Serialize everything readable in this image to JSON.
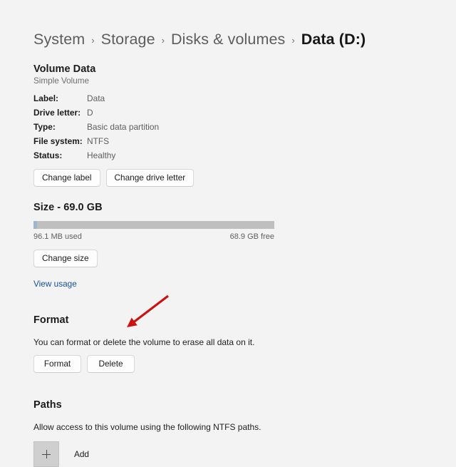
{
  "breadcrumb": {
    "separator": "›",
    "items": [
      {
        "label": "System",
        "current": false
      },
      {
        "label": "Storage",
        "current": false
      },
      {
        "label": "Disks & volumes",
        "current": false
      },
      {
        "label": "Data (D:)",
        "current": true
      }
    ]
  },
  "volume": {
    "title": "Volume Data",
    "subtitle": "Simple Volume",
    "properties": [
      {
        "key": "Label:",
        "value": "Data"
      },
      {
        "key": "Drive letter:",
        "value": "D"
      },
      {
        "key": "Type:",
        "value": "Basic data partition"
      },
      {
        "key": "File system:",
        "value": "NTFS"
      },
      {
        "key": "Status:",
        "value": "Healthy"
      }
    ],
    "change_label_button": "Change label",
    "change_drive_letter_button": "Change drive letter"
  },
  "size": {
    "title": "Size - 69.0 GB",
    "used_label": "96.1 MB used",
    "free_label": "68.9 GB free",
    "used_percent": 1.4,
    "change_size_button": "Change size",
    "view_usage_link": "View usage",
    "fill_color": "#9fb4cd",
    "track_color": "#bfbfbf"
  },
  "format": {
    "title": "Format",
    "description": "You can format or delete the volume to erase all data on it.",
    "format_button": "Format",
    "delete_button": "Delete"
  },
  "paths": {
    "title": "Paths",
    "description": "Allow access to this volume using the following NTFS paths.",
    "add_label": "Add",
    "add_icon": "plus-icon"
  },
  "annotation": {
    "type": "arrow",
    "color": "#cc1111",
    "points_to": "delete-button"
  }
}
